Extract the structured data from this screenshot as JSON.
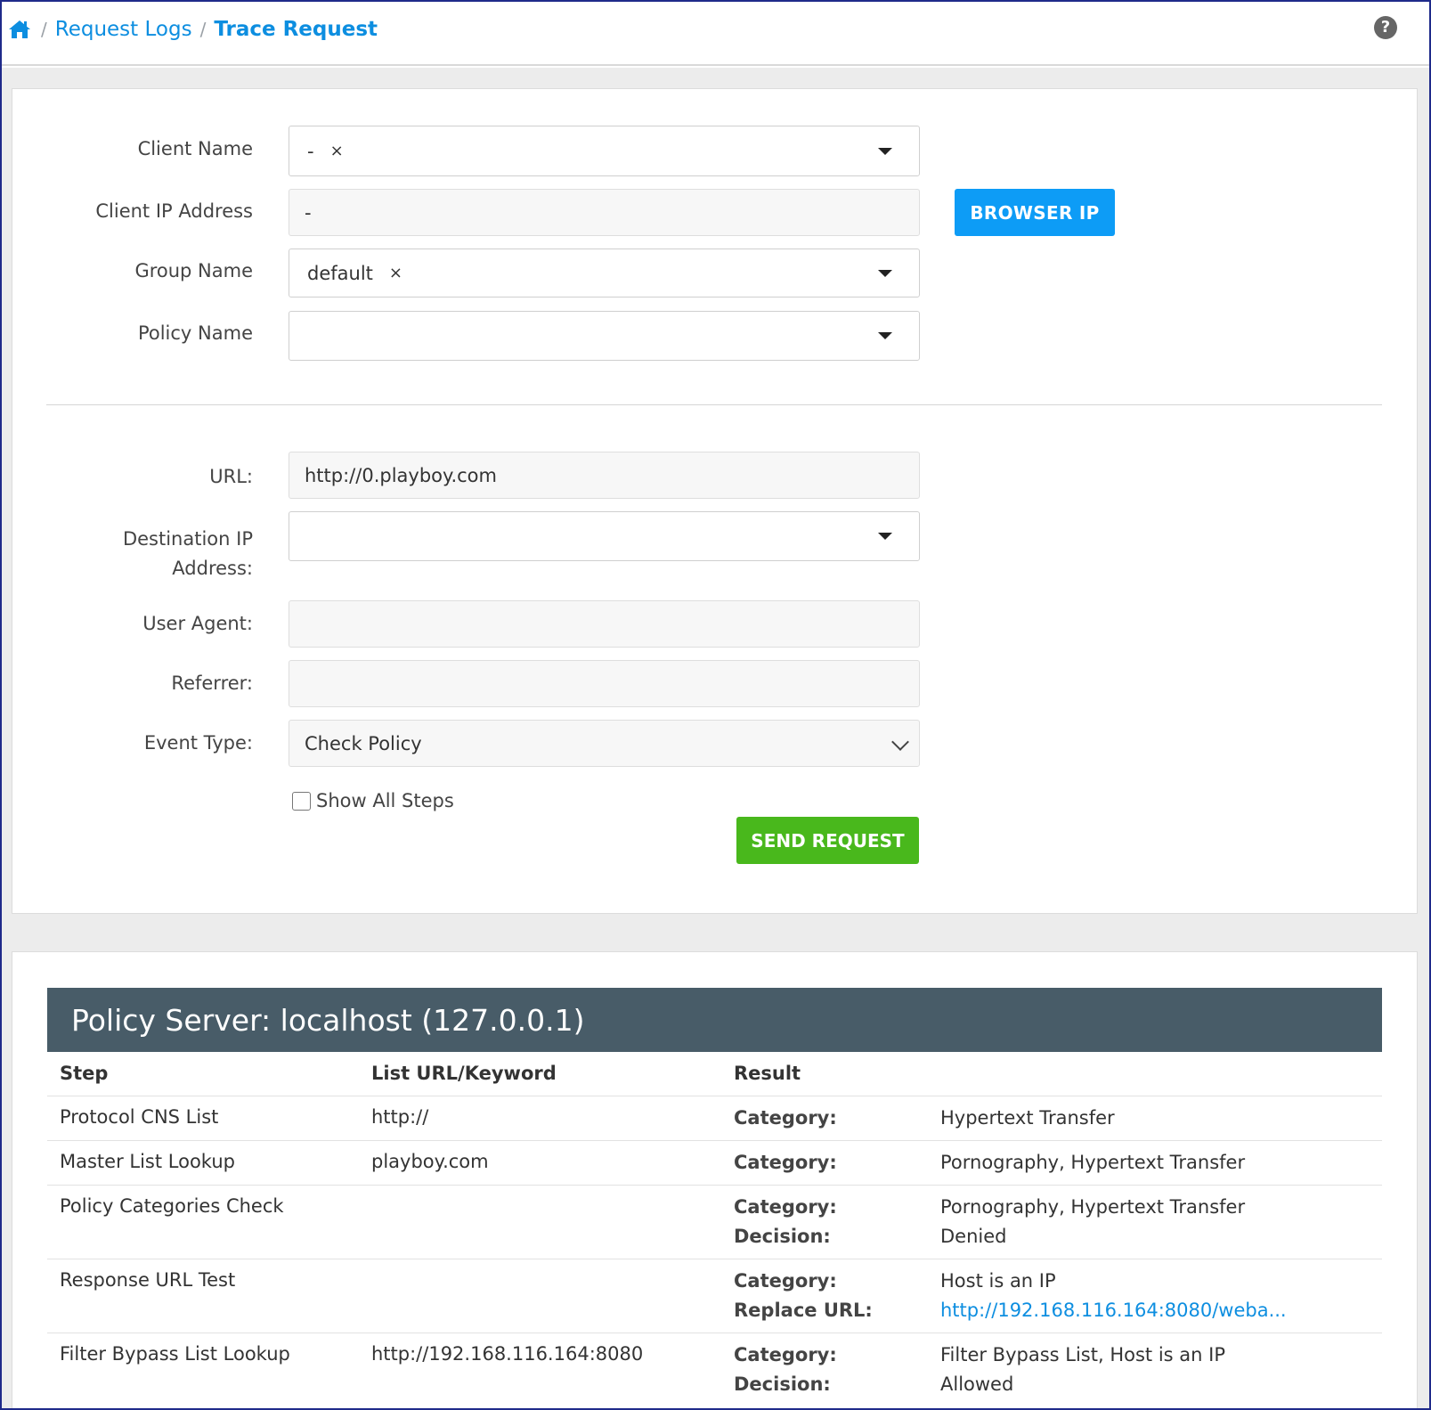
{
  "breadcrumb": {
    "home_icon": "home-icon",
    "sep1": "/",
    "request_logs": "Request Logs",
    "sep2": "/",
    "current": "Trace Request"
  },
  "help_icon": "?",
  "form": {
    "client_name": {
      "label": "Client Name",
      "value": "-",
      "clear": "×"
    },
    "client_ip": {
      "label": "Client IP Address",
      "value": "-"
    },
    "browser_ip_button": "BROWSER IP",
    "group_name": {
      "label": "Group Name",
      "value": "default",
      "clear": "×"
    },
    "policy_name": {
      "label": "Policy Name",
      "value": ""
    },
    "url": {
      "label": "URL:",
      "value": "http://0.playboy.com"
    },
    "destination_ip": {
      "label_line1": "Destination IP",
      "label_line2": "Address:",
      "value": ""
    },
    "user_agent": {
      "label": "User Agent:",
      "value": ""
    },
    "referrer": {
      "label": "Referrer:",
      "value": ""
    },
    "event_type": {
      "label": "Event Type:",
      "value": "Check Policy"
    },
    "show_all_steps": {
      "label": "Show All Steps",
      "checked": false
    },
    "send_button": "SEND REQUEST"
  },
  "results": {
    "server_title": "Policy Server: localhost (127.0.0.1)",
    "headers": {
      "step": "Step",
      "list": "List URL/Keyword",
      "result": "Result"
    },
    "rows": [
      {
        "step": "Protocol CNS List",
        "list": "http://",
        "k1": "Category:",
        "v1": "Hypertext Transfer"
      },
      {
        "step": "Master List Lookup",
        "list": "playboy.com",
        "k1": "Category:",
        "v1": "Pornography, Hypertext Transfer"
      },
      {
        "step": "Policy Categories Check",
        "list": "",
        "k1": "Category:",
        "v1": "Pornography, Hypertext Transfer",
        "k2": "Decision:",
        "v2": "Denied"
      },
      {
        "step": "Response URL Test",
        "list": "",
        "k1": "Category:",
        "v1": "Host is an IP",
        "k2": "Replace URL:",
        "v2": "http://192.168.116.164:8080/weba..."
      },
      {
        "step": "Filter Bypass List Lookup",
        "list": "http://192.168.116.164:8080",
        "k1": "Category:",
        "v1": "Filter Bypass List, Host is an IP",
        "k2": "Decision:",
        "v2": "Allowed"
      }
    ]
  },
  "colors": {
    "link": "#0d8ee0",
    "primary_button": "#0d9cf6",
    "success_button": "#49b81c",
    "server_header": "#485c68"
  }
}
